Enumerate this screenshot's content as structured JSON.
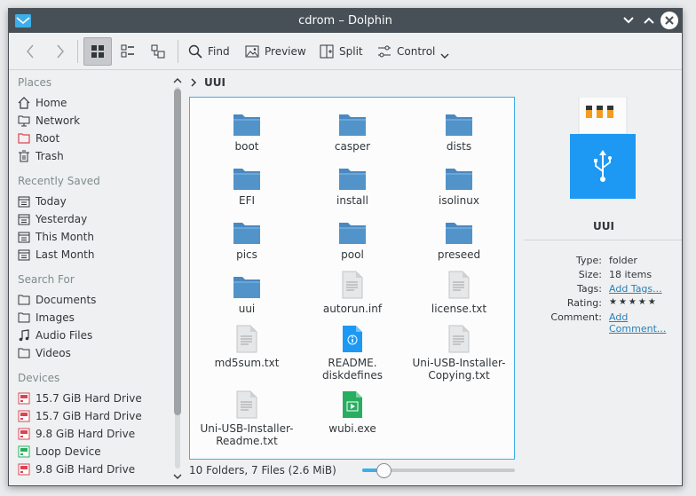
{
  "window": {
    "title": "cdrom – Dolphin"
  },
  "toolbar": {
    "find_label": "Find",
    "preview_label": "Preview",
    "split_label": "Split",
    "control_label": "Control"
  },
  "sidebar": {
    "sections": {
      "places": "Places",
      "recent": "Recently Saved",
      "search": "Search For",
      "devices": "Devices"
    },
    "places": [
      "Home",
      "Network",
      "Root",
      "Trash"
    ],
    "recent": [
      "Today",
      "Yesterday",
      "This Month",
      "Last Month"
    ],
    "search": [
      "Documents",
      "Images",
      "Audio Files",
      "Videos"
    ],
    "devices": [
      "15.7 GiB Hard Drive",
      "15.7 GiB Hard Drive",
      "9.8 GiB Hard Drive",
      "Loop Device",
      "9.8 GiB Hard Drive"
    ]
  },
  "breadcrumb": {
    "current": "UUI"
  },
  "files": [
    {
      "name": "boot",
      "icon": "folder-icon"
    },
    {
      "name": "casper",
      "icon": "folder-icon"
    },
    {
      "name": "dists",
      "icon": "folder-icon"
    },
    {
      "name": "EFI",
      "icon": "folder-icon"
    },
    {
      "name": "install",
      "icon": "folder-icon"
    },
    {
      "name": "isolinux",
      "icon": "folder-icon"
    },
    {
      "name": "pics",
      "icon": "folder-icon"
    },
    {
      "name": "pool",
      "icon": "folder-icon"
    },
    {
      "name": "preseed",
      "icon": "folder-icon"
    },
    {
      "name": "uui",
      "icon": "folder-icon"
    },
    {
      "name": "autorun.inf",
      "icon": "text-file-icon"
    },
    {
      "name": "license.txt",
      "icon": "text-file-icon"
    },
    {
      "name": "md5sum.txt",
      "icon": "text-file-icon"
    },
    {
      "name": "README.\ndiskdefines",
      "icon": "info-file-icon"
    },
    {
      "name": "Uni-USB-Installer-\nCopying.txt",
      "icon": "text-file-icon"
    },
    {
      "name": "Uni-USB-Installer-\nReadme.txt",
      "icon": "text-file-icon"
    },
    {
      "name": "wubi.exe",
      "icon": "executable-icon"
    }
  ],
  "status": {
    "summary": "10 Folders, 7 Files (2.6 MiB)",
    "zoom_fraction": 0.1
  },
  "info": {
    "title": "UUI",
    "type_label": "Type:",
    "type_value": "folder",
    "size_label": "Size:",
    "size_value": "18 items",
    "tags_label": "Tags:",
    "tags_value": "Add Tags...",
    "rating_label": "Rating:",
    "rating_value": "★★★★★",
    "comment_label": "Comment:",
    "comment_value": "Add Comment..."
  },
  "colors": {
    "accent": "#3daee9",
    "titlebar": "#475057",
    "folder": "#5294c9"
  }
}
